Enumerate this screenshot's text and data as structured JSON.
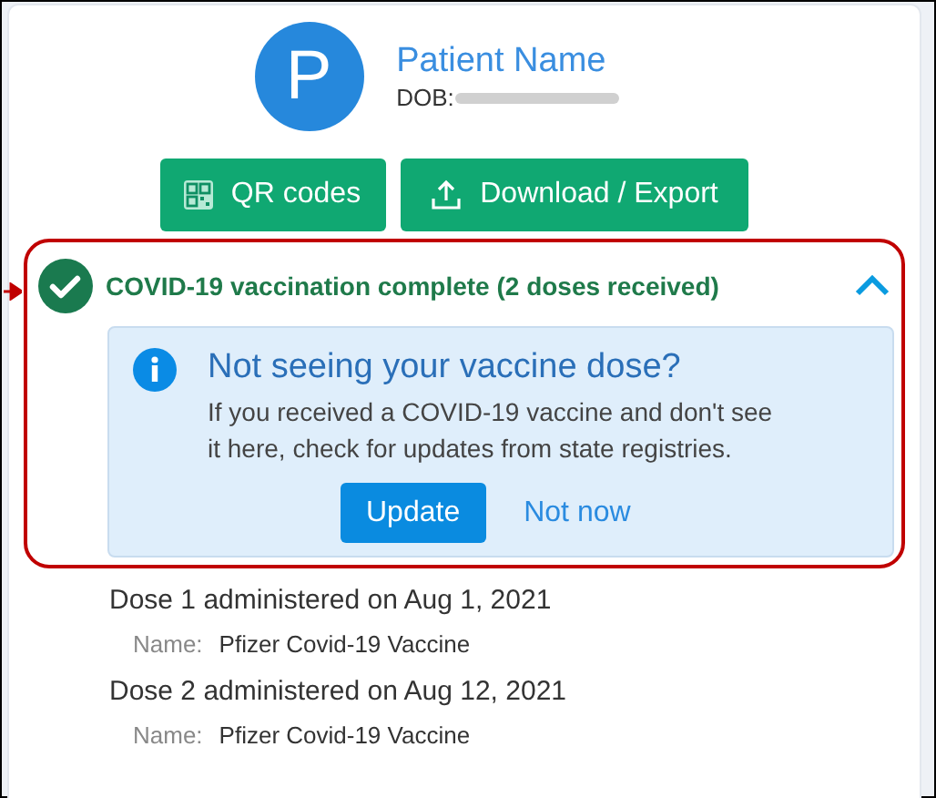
{
  "patient": {
    "avatar_letter": "P",
    "name": "Patient Name",
    "dob_label": "DOB:"
  },
  "buttons": [
    {
      "label": "QR codes",
      "kind": "qr"
    },
    {
      "label": "Download / Export",
      "kind": "export"
    }
  ],
  "status": {
    "text": "COVID-19 vaccination complete (2 doses received)",
    "expanded": true
  },
  "notice": {
    "title": "Not seeing your vaccine dose?",
    "text": "If you received a COVID-19 vaccine and don't see it here, check for updates from state registries.",
    "actions": [
      {
        "label": "Update",
        "kind": "primary"
      },
      {
        "label": "Not now",
        "kind": "link"
      }
    ]
  },
  "doses": [
    {
      "title": "Dose 1 administered on Aug 1, 2021",
      "name_label": "Name:",
      "name": "Pfizer Covid-19 Vaccine"
    },
    {
      "title": "Dose 2 administered on Aug 12, 2021",
      "name_label": "Name:",
      "name": "Pfizer Covid-19 Vaccine"
    }
  ]
}
